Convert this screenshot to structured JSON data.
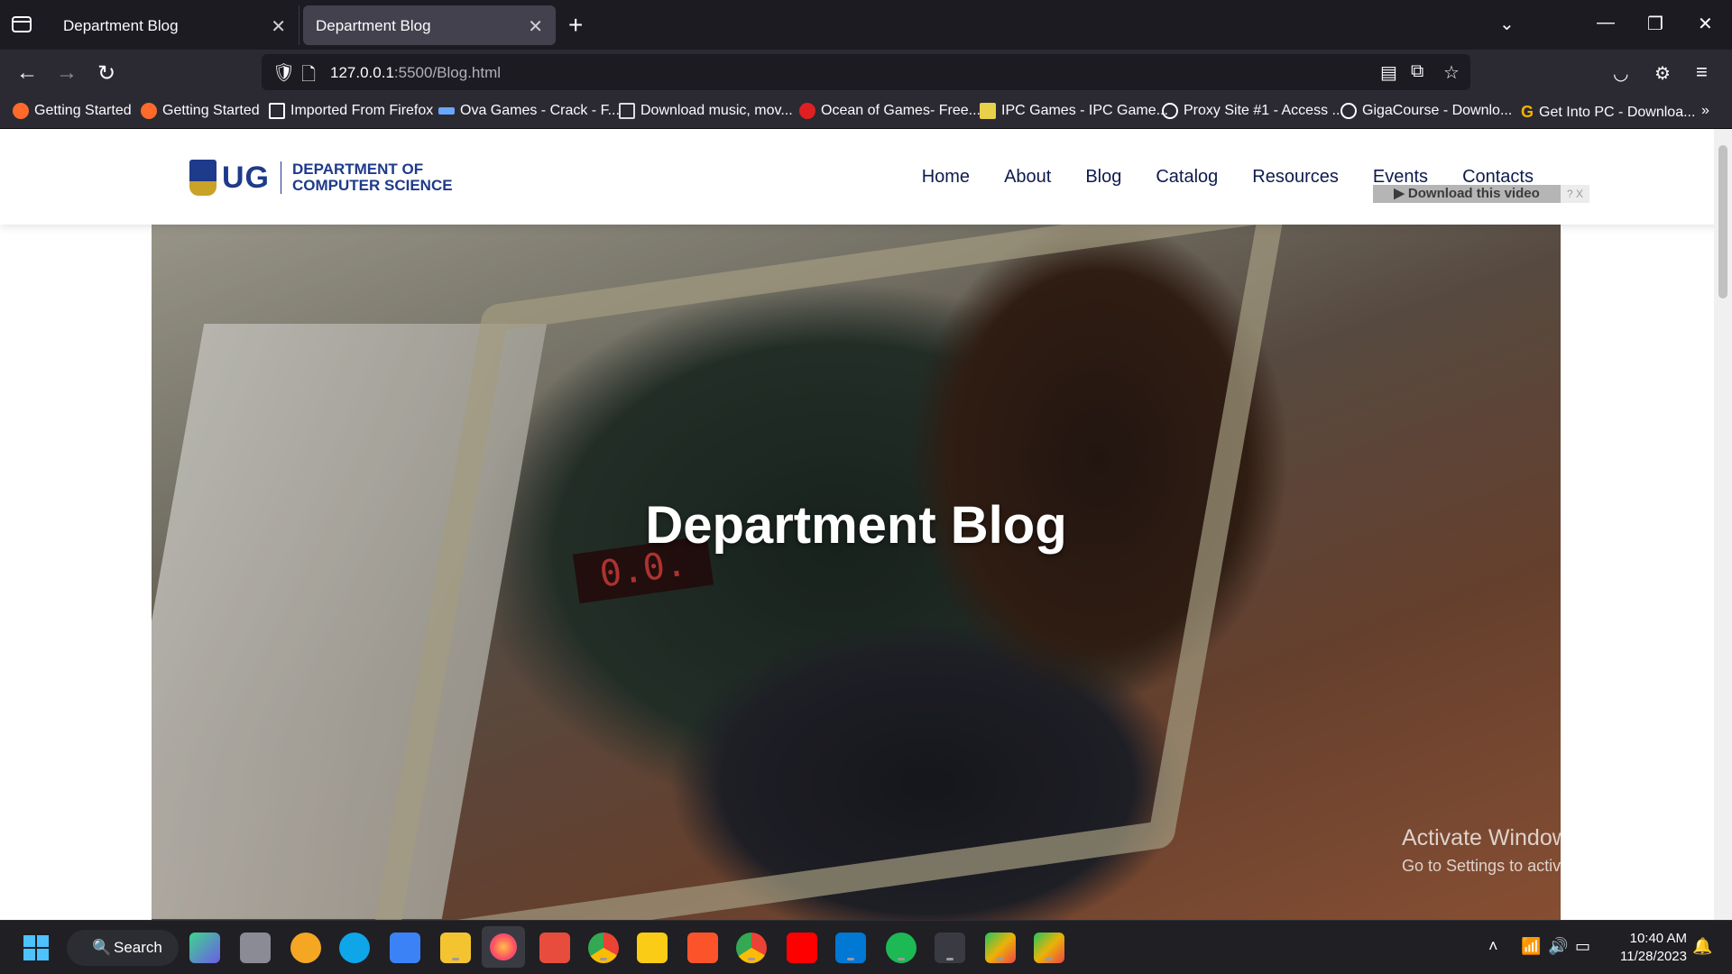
{
  "browser": {
    "tabs": [
      {
        "title": "Department Blog",
        "active": false
      },
      {
        "title": "Department Blog",
        "active": true
      }
    ],
    "new_tab_label": "+",
    "url_host": "127.0.0.1",
    "url_path": ":5500/Blog.html",
    "bookmarks": [
      {
        "label": "Getting Started",
        "icon": "firefox-icon",
        "color": "#ff6a2b"
      },
      {
        "label": "Getting Started",
        "icon": "firefox-icon",
        "color": "#ff6a2b"
      },
      {
        "label": "Imported From Firefox",
        "icon": "folder-icon",
        "color": "#ffffff"
      },
      {
        "label": "Ova Games - Crack - F...",
        "icon": "ova-icon",
        "color": "#6aa6ff"
      },
      {
        "label": "Download music, mov...",
        "icon": "monitor-icon",
        "color": "#dddddd"
      },
      {
        "label": "Ocean of Games- Free...",
        "icon": "ocean-icon",
        "color": "#e02020"
      },
      {
        "label": "IPC Games - IPC Game...",
        "icon": "ipc-icon",
        "color": "#e8d04a"
      },
      {
        "label": "Proxy Site #1 - Access ...",
        "icon": "globe-icon",
        "color": "#ffffff"
      },
      {
        "label": "GigaCourse - Downlo...",
        "icon": "globe-icon",
        "color": "#ffffff"
      },
      {
        "label": "Get Into PC - Downloa...",
        "icon": "g-icon",
        "color": "#f4b400"
      }
    ]
  },
  "site": {
    "logo_ug": "UG",
    "logo_line1": "DEPARTMENT OF",
    "logo_line2": "COMPUTER SCIENCE",
    "nav": [
      "Home",
      "About",
      "Blog",
      "Catalog",
      "Resources",
      "Events",
      "Contacts"
    ],
    "hero_title": "Department Blog",
    "led_text": "0.0.",
    "download_video": "▶ Download this video",
    "download_extra": "? X",
    "brand_color": "#1e3a8a"
  },
  "watermark": {
    "line1": "Activate Windows",
    "line2": "Go to Settings to activate Windows."
  },
  "taskbar": {
    "search_label": "Search",
    "time": "10:40 AM",
    "date": "11/28/2023"
  }
}
